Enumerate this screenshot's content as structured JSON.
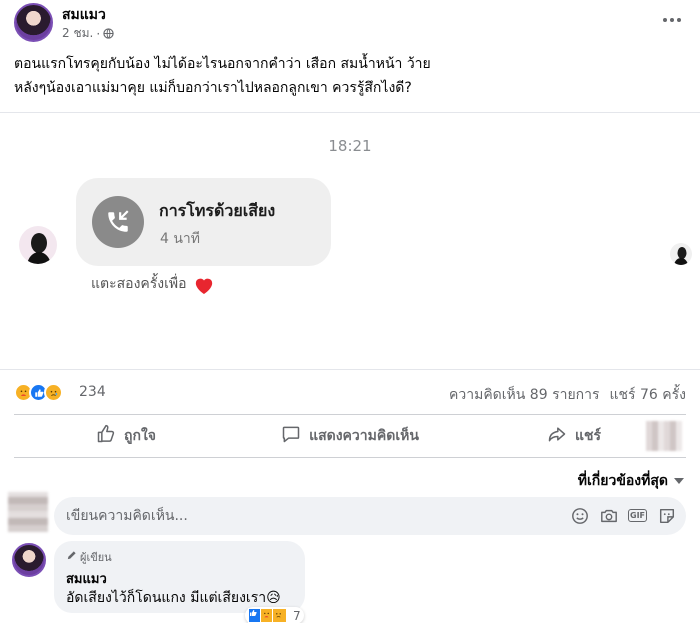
{
  "post": {
    "author": "สมแมว",
    "time": "2 ชม.",
    "separator": "·",
    "audience_icon": "globe-icon",
    "text_line1": "ตอนแรกโทรคุยกับน้อง ไม่ได้อะไรนอกจากคำว่า เสือก สมน้ำหน้า ว้าย",
    "text_line2": "หลังๆน้องเอาแม่มาคุย แม่ก็บอกว่าเราไปหลอกลูกเขา ควรรู้สึกไงดี?"
  },
  "screenshot": {
    "time": "18:21",
    "call_title": "การโทรด้วยเสียง",
    "call_duration": "4 นาที",
    "call_icon": "phone-callback-icon",
    "reaction_text": "แตะสองครั้งเพื่อ",
    "reaction_icon": "heart-icon"
  },
  "summary": {
    "reaction_icons": [
      "care-reaction-icon",
      "like-reaction-icon",
      "sad-reaction-icon"
    ],
    "reaction_count": "234",
    "comments": "ความคิดเห็น 89 รายการ",
    "shares": "แชร์ 76 ครั้ง"
  },
  "actions": {
    "like": "ถูกใจ",
    "comment": "แสดงความคิดเห็น",
    "share": "แชร์"
  },
  "sort": {
    "label": "ที่เกี่ยวข้องที่สุด"
  },
  "composer": {
    "placeholder": "เขียนความคิดเห็น...",
    "icons": [
      "emoji-icon",
      "camera-icon",
      "gif-icon",
      "sticker-icon"
    ]
  },
  "comment": {
    "badge": "ผู้เขียน",
    "author": "สมแมว",
    "text": "อัดเสียงไว้ก็โดนแกง มีแต่เสียงเรา😥",
    "reaction_count": "7"
  },
  "colors": {
    "accent": "#1877f2",
    "secondary_text": "#65676b",
    "composer_bg": "#f0f2f5"
  }
}
